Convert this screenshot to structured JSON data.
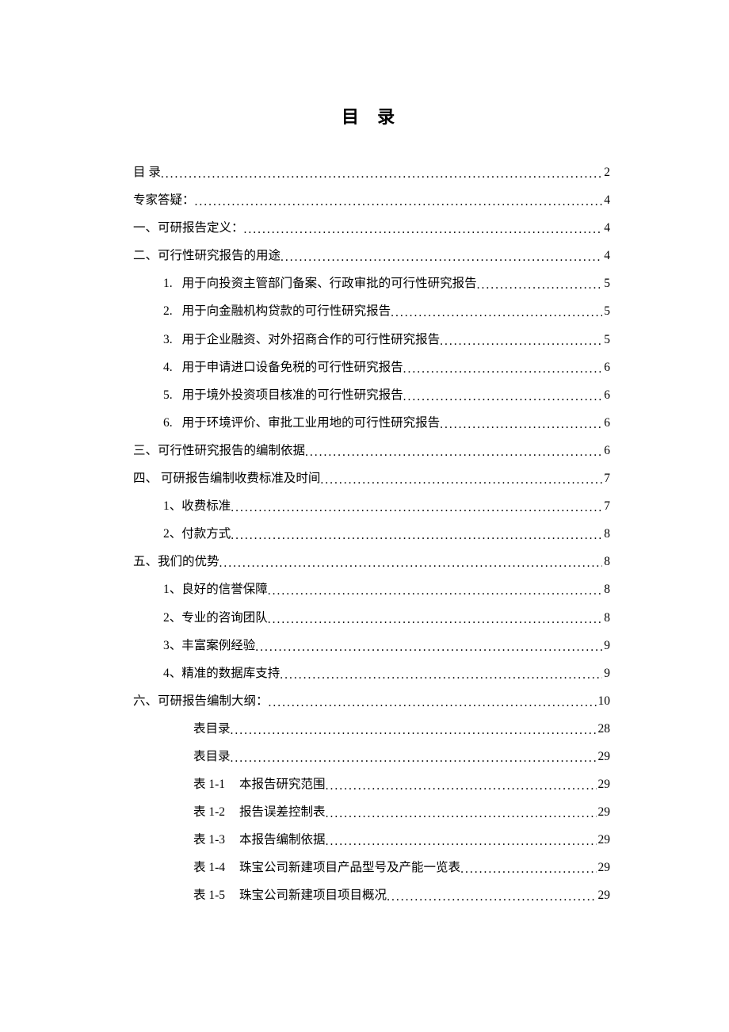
{
  "title": "目 录",
  "toc": [
    {
      "level": 0,
      "label": "目 录",
      "page": "2"
    },
    {
      "level": 0,
      "label": "专家答疑：",
      "page": "4"
    },
    {
      "level": 0,
      "label": "一、可研报告定义：",
      "page": "4"
    },
    {
      "level": 0,
      "label": "二、可行性研究报告的用途",
      "page": "4"
    },
    {
      "level": 1,
      "numPrefix": "1.",
      "label": "用于向投资主管部门备案、行政审批的可行性研究报告",
      "page": "5"
    },
    {
      "level": 1,
      "numPrefix": "2.",
      "label": "用于向金融机构贷款的可行性研究报告",
      "page": "5"
    },
    {
      "level": 1,
      "numPrefix": "3.",
      "label": "用于企业融资、对外招商合作的可行性研究报告",
      "page": "5"
    },
    {
      "level": 1,
      "numPrefix": "4.",
      "label": "用于申请进口设备免税的可行性研究报告",
      "page": "6"
    },
    {
      "level": 1,
      "numPrefix": "5.",
      "label": "用于境外投资项目核准的可行性研究报告",
      "page": "6"
    },
    {
      "level": 1,
      "numPrefix": "6.",
      "label": "用于环境评价、审批工业用地的可行性研究报告",
      "page": "6"
    },
    {
      "level": 0,
      "label": "三、可行性研究报告的编制依据",
      "page": "6"
    },
    {
      "level": 0,
      "label": "四、 可研报告编制收费标准及时间",
      "page": "7"
    },
    {
      "level": 1,
      "label": "1、收费标准",
      "page": "7"
    },
    {
      "level": 1,
      "label": "2、付款方式",
      "page": "8"
    },
    {
      "level": 0,
      "label": "五、我们的优势",
      "page": "8"
    },
    {
      "level": 1,
      "label": "1、良好的信誉保障",
      "page": "8"
    },
    {
      "level": 1,
      "label": "2、专业的咨询团队",
      "page": "8"
    },
    {
      "level": 1,
      "label": "3、丰富案例经验",
      "page": "9"
    },
    {
      "level": 1,
      "label": "4、精准的数据库支持",
      "page": "9"
    },
    {
      "level": 0,
      "label": "六、可研报告编制大纲：",
      "page": "10"
    },
    {
      "level": 2,
      "label": "表目录",
      "page": "28"
    },
    {
      "level": 2,
      "label": "表目录",
      "page": "29"
    },
    {
      "level": 2,
      "tablePrefix": "表 1-1",
      "label": "本报告研究范围",
      "page": "29"
    },
    {
      "level": 2,
      "tablePrefix": "表 1-2",
      "label": "报告误差控制表",
      "page": "29"
    },
    {
      "level": 2,
      "tablePrefix": "表 1-3",
      "label": "本报告编制依据",
      "page": "29"
    },
    {
      "level": 2,
      "tablePrefix": "表 1-4",
      "label": "珠宝公司新建项目产品型号及产能一览表",
      "page": "29"
    },
    {
      "level": 2,
      "tablePrefix": "表 1-5",
      "label": "珠宝公司新建项目项目概况",
      "page": "29"
    }
  ]
}
